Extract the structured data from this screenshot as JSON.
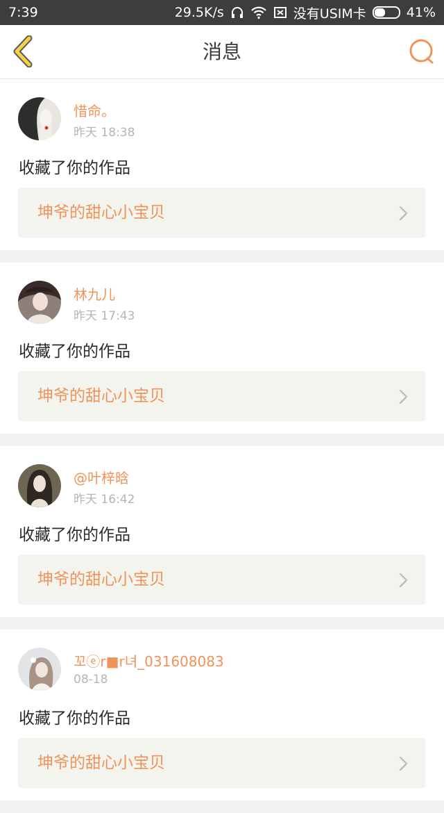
{
  "status_bar": {
    "time": "7:39",
    "speed": "29.5K/s",
    "sim_text": "没有USIM卡",
    "battery_text": "41%",
    "battery_level": 0.41,
    "icons": [
      "headset-icon",
      "wifi-icon",
      "no-sim-icon",
      "battery-icon"
    ]
  },
  "nav": {
    "title": "消息",
    "back_icon": "chevron-left-icon",
    "search_icon": "search-icon"
  },
  "colors": {
    "accent": "#f0935a",
    "back_icon": "#f3d24a",
    "status_bar_bg": "#3d3d3d",
    "card_bg": "#ffffff",
    "work_bg": "#f4f4ee",
    "page_bg": "#f2f2f2"
  },
  "messages": [
    {
      "user": "惜命。",
      "time": "昨天 18:38",
      "action": "收藏了你的作品",
      "work_title": "坤爷的甜心小宝贝"
    },
    {
      "user": "林九儿",
      "time": "昨天 17:43",
      "action": "收藏了你的作品",
      "work_title": "坤爷的甜心小宝贝"
    },
    {
      "user": "@叶梓晗",
      "time": "昨天 16:42",
      "action": "收藏了你的作品",
      "work_title": "坤爷的甜心小宝贝"
    },
    {
      "user": "꼬ⓔr■r녀_031608083",
      "time": "08-18",
      "action": "收藏了你的作品",
      "work_title": "坤爷的甜心小宝贝"
    }
  ]
}
